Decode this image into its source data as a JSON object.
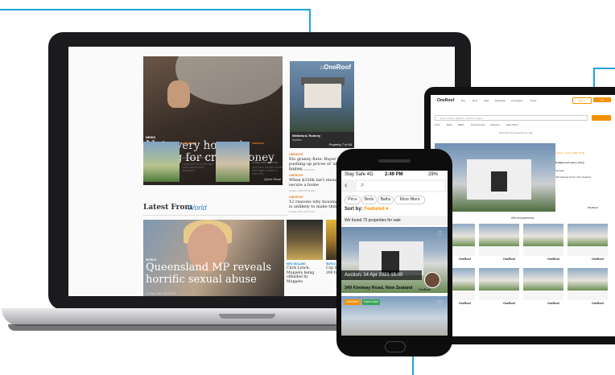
{
  "laptop": {
    "hero": {
      "tag": "NEWS",
      "title": "Not every house is selling for crazy money",
      "meta": "19 May, 2021 05:38 AM",
      "quick_read": "Quick Read"
    },
    "oneroof_card": {
      "logo": "⌂OneRoof",
      "location": "Wellsford, Rodney",
      "sublabel": "Auction",
      "property_count": "Property 7 of 64"
    },
    "side_stories": [
      {
        "tag": "ONEROOF",
        "headline": "Elo granny flats: Buyer hunger pushing up prices of 'affordable' homes",
        "meta": "19 May, 2021 05:36 AM"
      },
      {
        "tag": "ONEROOF",
        "headline": "When $330k isn't enough to secure a home",
        "meta": "19 May, 2021 05:30 AM"
      },
      {
        "tag": "ONEROOF",
        "headline": "12 reasons why housing market is unlikely to make things worse",
        "meta": "19 May, 2021 05:25 AM"
      }
    ],
    "mini_stories": [
      {
        "tag": "ONEROOF",
        "headline": "Polluted Auckland tennis court sells for $2.2m",
        "sub": "Large block of vacant land draws interest from developers.",
        "meta": "19 May, 2021 05:20 AM"
      },
      {
        "tag": "ONEROOF",
        "headline": "Why tiny homes won't solve the property market problem",
        "sub": "Comment: Smaller homes face bigger hurdles to overcome",
        "meta": "19 May, 2021 05:15 AM"
      }
    ],
    "latest_from": "Latest From",
    "latest_section": "World",
    "qld": {
      "tag": "WORLD",
      "title": "Queensland MP reveals horrific sexual abuse",
      "meta": "19 May, 2021 05:05 PM"
    },
    "bottom_stories": [
      {
        "tag": "NEW ZEALAND",
        "headline": "Chris Lynch: Muppets being offended by Muppets"
      },
      {
        "tag": "WORLD",
        "headline": "Cop throws after 200 found in"
      }
    ]
  },
  "tablet": {
    "logo_text": "OneRoof",
    "nav": [
      "Buy",
      "Rent",
      "Sold",
      "Estimates",
      "Find agent",
      "News"
    ],
    "sign_in": "Sign in",
    "list_button": "List",
    "search_placeholder": "Enter suburb, address, district or region",
    "filters": [
      "Price",
      "Beds",
      "Baths",
      "Property type",
      "Features",
      "More filters"
    ],
    "results_text": "We found 72 properties for sale",
    "side_lines": [
      "Auction, 14 Apr 2021 15:00",
      "Enlightened luxury living",
      "Vantage",
      "349 Kiwiway Road, New Zealand",
      "OneRoof"
    ],
    "recommend": "We recommend",
    "grid_logo": "OneRoof"
  },
  "phone": {
    "carrier": "Stay Safe 4G",
    "time": "2:49 PM",
    "battery": "29%",
    "back_icon": "‹",
    "search_icon": "⌕",
    "chips": [
      "Price",
      "Beds",
      "Baths",
      "More filters"
    ],
    "sort_label": "Sort by:",
    "sort_value": "Featured ▾",
    "found_text": "We found 72 properties for sale",
    "auction": "Auction, 14 Apr 2021 15:00",
    "address": "349 Kiwiway Road, New Zealand",
    "agent_logo": "OneRoof",
    "badges": [
      "Just listed",
      "Open home"
    ]
  },
  "colors": {
    "callout": "#1fa3dc",
    "oneroof_orange": "#f39200",
    "link_blue": "#3d7fc1"
  }
}
